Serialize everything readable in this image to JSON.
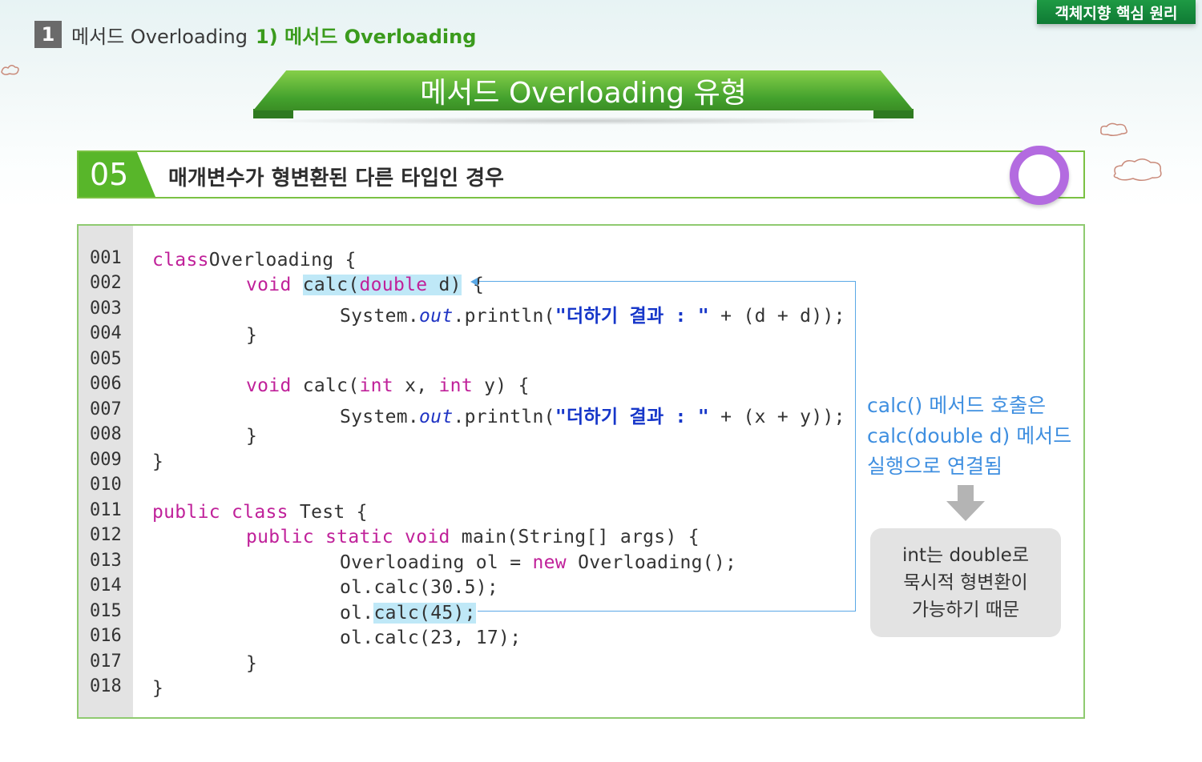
{
  "header": {
    "corner_badge": "객체지향 핵심 원리",
    "breadcrumb": {
      "number": "1",
      "topic": "메서드 Overloading",
      "subtopic": "1) 메서드 Overloading"
    },
    "banner_title": "메서드 Overloading 유형"
  },
  "section": {
    "number": "05",
    "title": "매개변수가 형변환된 다른 타입인 경우"
  },
  "code": {
    "line_numbers": [
      "001",
      "002",
      "003",
      "004",
      "005",
      "006",
      "007",
      "008",
      "009",
      "010",
      "011",
      "012",
      "013",
      "014",
      "015",
      "016",
      "017",
      "018"
    ]
  },
  "note": {
    "lines": [
      "calc() 메서드 호출은",
      "calc(double d) 메서드",
      "실행으로 연결됨"
    ],
    "bubble_lines": [
      "int는 double로",
      "묵시적 형변환이",
      "가능하기 때문"
    ]
  },
  "colors": {
    "green": "#58b62a",
    "blue_note": "#3f8fe0",
    "keyword": "#c0219a",
    "string": "#1636c9"
  }
}
